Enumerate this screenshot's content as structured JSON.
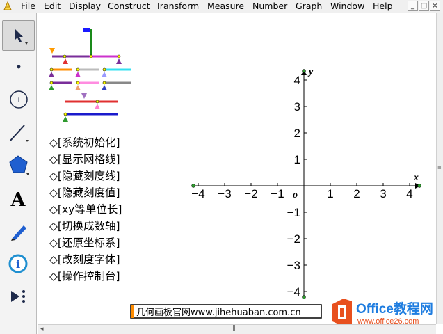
{
  "menubar": {
    "items": [
      "File",
      "Edit",
      "Display",
      "Construct",
      "Transform",
      "Measure",
      "Number",
      "Graph",
      "Window",
      "Help"
    ],
    "window_buttons": [
      "_",
      "□",
      "×"
    ]
  },
  "toolbox": {
    "tools": [
      "arrow-select-tool-icon",
      "point-tool-icon",
      "compass-tool-icon",
      "straightedge-tool-icon",
      "polygon-tool-icon",
      "text-tool-icon",
      "marker-tool-icon",
      "information-tool-icon",
      "custom-tool-icon"
    ],
    "text_tool_glyph": "A"
  },
  "buttons": [
    {
      "label": "◇[系统初始化]"
    },
    {
      "label": "◇[显示网格线]"
    },
    {
      "label": "◇[隐藏刻度线]"
    },
    {
      "label": "◇[隐藏刻度值]"
    },
    {
      "label": "◇[xy等单位长]"
    },
    {
      "label": "◇[切换成数轴]"
    },
    {
      "label": "◇[还原坐标系]"
    },
    {
      "label": "◇[改刻度字体]"
    },
    {
      "label": "◇[操作控制台]"
    }
  ],
  "graph": {
    "x_label": "x",
    "y_label": "y",
    "origin_label": "o",
    "x_ticks": [
      {
        "v": -4,
        "t": "−4"
      },
      {
        "v": -3,
        "t": "−3"
      },
      {
        "v": -2,
        "t": "−2"
      },
      {
        "v": -1,
        "t": "−1"
      },
      {
        "v": 1,
        "t": "1"
      },
      {
        "v": 2,
        "t": "2"
      },
      {
        "v": 3,
        "t": "3"
      },
      {
        "v": 4,
        "t": "4"
      }
    ],
    "y_ticks": [
      {
        "v": 4,
        "t": "4"
      },
      {
        "v": 3,
        "t": "3"
      },
      {
        "v": 2,
        "t": "2"
      },
      {
        "v": 1,
        "t": "1"
      },
      {
        "v": -1,
        "t": "−1"
      },
      {
        "v": -2,
        "t": "−2"
      },
      {
        "v": -3,
        "t": "−3"
      },
      {
        "v": -4,
        "t": "−4"
      }
    ]
  },
  "footer": {
    "site_text": "几何画板官网www.jihehuaban.com.cn"
  },
  "watermark": {
    "brand": "Office教程网",
    "url": "www.office26.com"
  },
  "scrollbar": {
    "grip": "|||"
  },
  "colors": {
    "green": "#2e9a2e",
    "red": "#e03030",
    "blue": "#1a1aff",
    "orange": "#ff7f00",
    "purple": "#7a2e9a",
    "magenta": "#cc33cc",
    "cyan": "#33e0f0",
    "gray": "#999999"
  }
}
